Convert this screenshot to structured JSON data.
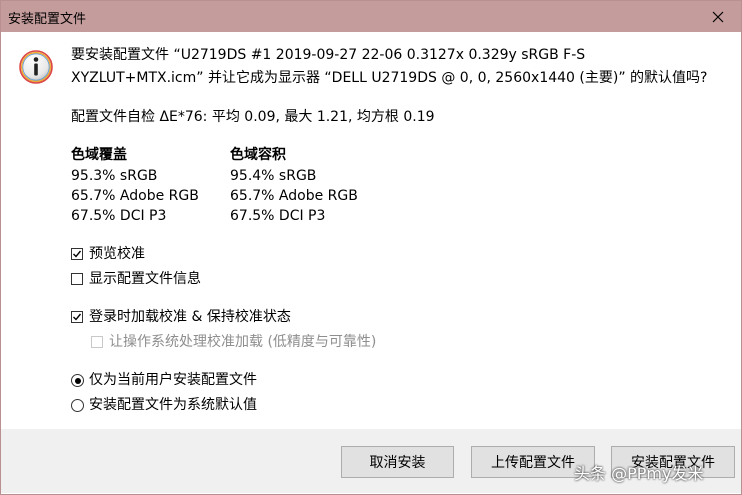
{
  "window": {
    "title": "安装配置文件"
  },
  "message": {
    "line1": "要安装配置文件 “U2719DS #1 2019-09-27 22-06 0.3127x 0.329y sRGB F-S",
    "line2": "XYZLUT+MTX.icm” 并让它成为显示器 “DELL U2719DS @ 0, 0, 2560x1440 (主要)” 的默认值吗?"
  },
  "self_check": "配置文件自检 ΔE*76: 平均 0.09, 最大 1.21, 均方根 0.19",
  "gamut_coverage": {
    "heading": "色域覆盖",
    "rows": [
      "95.3% sRGB",
      "65.7% Adobe RGB",
      "67.5% DCI P3"
    ]
  },
  "gamut_volume": {
    "heading": "色域容积",
    "rows": [
      "95.4% sRGB",
      "65.7% Adobe RGB",
      "67.5% DCI P3"
    ]
  },
  "options": {
    "preview_calibration": {
      "label": "预览校准",
      "checked": true
    },
    "show_profile_info": {
      "label": "显示配置文件信息",
      "checked": false
    },
    "load_on_login": {
      "label": "登录时加载校准 & 保持校准状态",
      "checked": true
    },
    "os_handle_loading": {
      "label": "让操作系统处理校准加载 (低精度与可靠性)",
      "checked": false,
      "disabled": true
    }
  },
  "install_scope": {
    "current_user": {
      "label": "仅为当前用户安装配置文件",
      "selected": true
    },
    "system_default": {
      "label": "安装配置文件为系统默认值",
      "selected": false
    }
  },
  "buttons": {
    "cancel": "取消安装",
    "upload": "上传配置文件",
    "install": "安装配置文件"
  },
  "watermark": "头条 @PPmy发米",
  "colors": {
    "titlebar": "#c59c9c",
    "footer": "#f0f0f0",
    "button": "#e1e1e1"
  }
}
